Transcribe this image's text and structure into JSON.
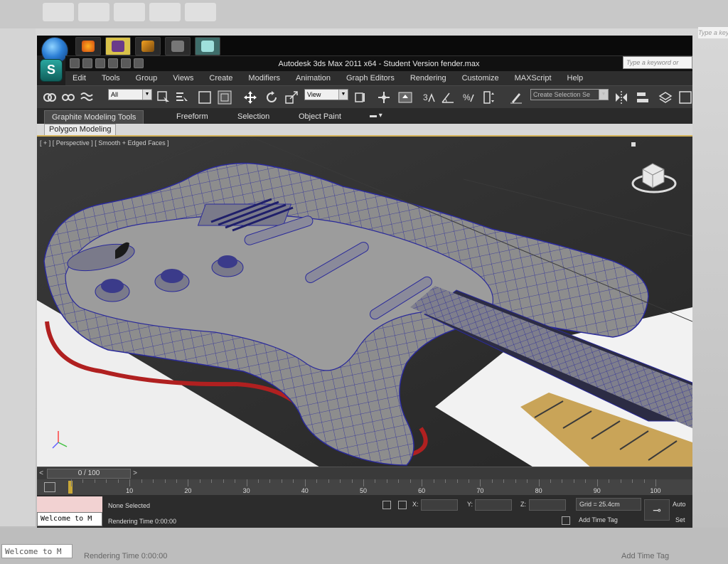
{
  "background": {
    "welcome_text": "Welcome to M",
    "rendering_time": "Rendering Time  0:00:00",
    "add_time_tag": "Add Time Tag",
    "search_placeholder": "Type a keyword"
  },
  "window": {
    "title": "Autodesk 3ds Max  2011 x64  -  Student Version    fender.max",
    "search_placeholder": "Type a keyword or"
  },
  "menu": [
    "Edit",
    "Tools",
    "Group",
    "Views",
    "Create",
    "Modifiers",
    "Animation",
    "Graph Editors",
    "Rendering",
    "Customize",
    "MAXScript",
    "Help"
  ],
  "toolbar": {
    "selection_filter": "All",
    "reference_coord": "View",
    "named_selection": "Create Selection Se"
  },
  "ribbon": {
    "tabs": [
      "Graphite Modeling Tools",
      "Freeform",
      "Selection",
      "Object Paint"
    ],
    "active_panel": "Polygon Modeling"
  },
  "viewport": {
    "label": "[ + ] [ Perspective ] [ Smooth + Edged Faces ]"
  },
  "timeline": {
    "frame_readout": "0 / 100",
    "ticks": [
      "10",
      "20",
      "30",
      "40",
      "50",
      "60",
      "70",
      "80",
      "90",
      "100"
    ]
  },
  "status": {
    "welcome_text": "Welcome to M",
    "selection": "None Selected",
    "rendering_time": "Rendering Time  0:00:00",
    "x_label": "X:",
    "y_label": "Y:",
    "z_label": "Z:",
    "grid": "Grid = 25.4cm",
    "add_time_tag": "Add Time Tag",
    "auto_key": "Auto",
    "set_key": "Set"
  },
  "colors": {
    "wire": "#2a2a9a",
    "body": "#8d8d8d",
    "accent": "#d4b35a"
  }
}
